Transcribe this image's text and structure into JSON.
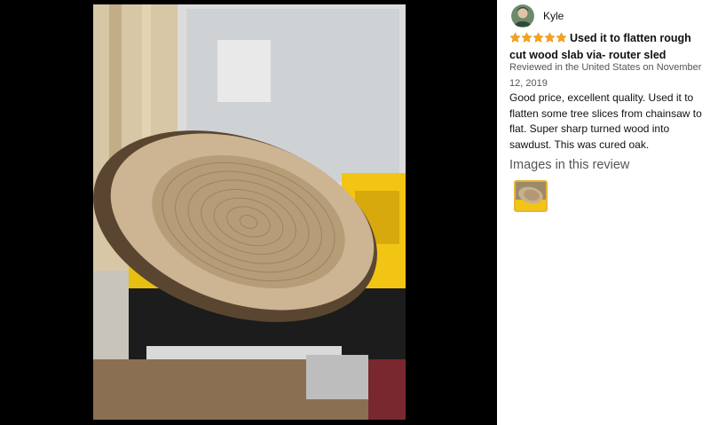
{
  "review": {
    "author": "Kyle",
    "rating": 5,
    "title": "Used it to flatten rough cut wood slab via- router sled",
    "reviewed_line": "Reviewed in the United States on November 12, 2019",
    "body": "Good price, excellent quality. Used it to flatten some tree slices from chainsaw to flat. Super sharp turned wood into sawdust. This was cured oak.",
    "images_heading": "Images in this review"
  },
  "colors": {
    "star": "#f7a21b",
    "thumb_border": "#e8b53a",
    "viewer_bg": "#000000"
  },
  "icons": [
    "star-icon",
    "avatar-icon"
  ]
}
